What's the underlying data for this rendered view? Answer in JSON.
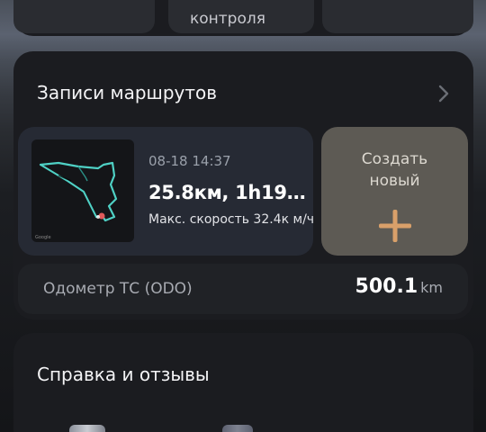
{
  "top_tiles": [
    {
      "label": ""
    },
    {
      "label": "контроля"
    },
    {
      "label": ""
    }
  ],
  "routes": {
    "title": "Записи маршрутов",
    "chevron_icon": "chevron-right-icon",
    "record": {
      "date": "08-18 14:37",
      "summary": "25.8км, 1h19…",
      "max_speed": "Макс. скорость 32.4к м/ч",
      "map_watermark": "Google"
    },
    "create": {
      "label": "Создать новый",
      "icon": "plus-icon",
      "accent": "#d9a06a"
    }
  },
  "odometer": {
    "label": "Одометр ТС (ODO)",
    "value": "500.1",
    "unit": "km"
  },
  "help": {
    "title": "Справка и отзывы",
    "icons": [
      "document-icon",
      "message-icon"
    ]
  },
  "colors": {
    "route_line": "#4fd1c5",
    "route_marker": "#e05a5a",
    "card_bg": "#1b1c20"
  }
}
